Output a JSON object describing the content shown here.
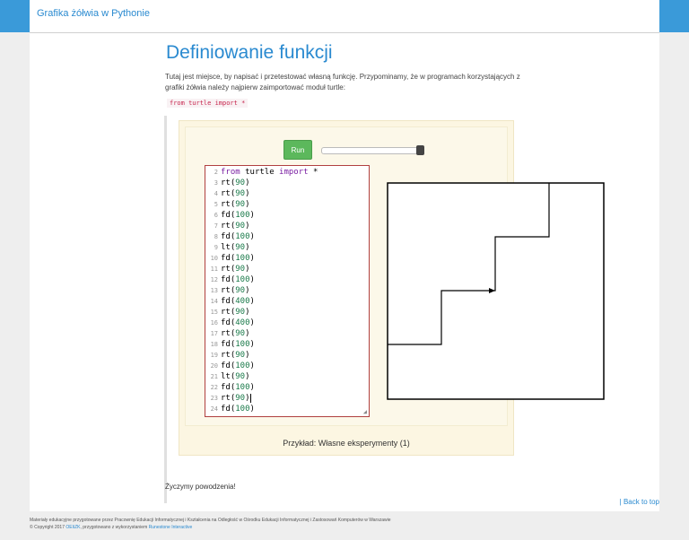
{
  "navbar": {
    "brand": "Grafika żółwia w Pythonie"
  },
  "page": {
    "title": "Definiowanie funkcji",
    "intro": "Tutaj jest miejsce, by napisać i przetestować własną funkcję. Przypominamy, że w programach korzystających z grafiki żółwia należy najpierw zaimportować moduł turtle:",
    "import_code": "from turtle import *",
    "closing": "Życzymy powodzenia!",
    "back_to_top": "| Back to top"
  },
  "activity": {
    "run_label": "Run",
    "speed_value": 1.0,
    "caption": "Przykład: Własne eksperymenty (1)",
    "code_lines": [
      {
        "n": "2",
        "text": "from turtle import *"
      },
      {
        "n": "3",
        "text": "rt(90)"
      },
      {
        "n": "4",
        "text": "rt(90)"
      },
      {
        "n": "5",
        "text": "rt(90)"
      },
      {
        "n": "6",
        "text": "fd(100)"
      },
      {
        "n": "7",
        "text": "rt(90)"
      },
      {
        "n": "8",
        "text": "fd(100)"
      },
      {
        "n": "9",
        "text": "lt(90)"
      },
      {
        "n": "10",
        "text": "fd(100)"
      },
      {
        "n": "11",
        "text": "rt(90)"
      },
      {
        "n": "12",
        "text": "fd(100)"
      },
      {
        "n": "13",
        "text": "rt(90)"
      },
      {
        "n": "14",
        "text": "fd(400)"
      },
      {
        "n": "15",
        "text": "rt(90)"
      },
      {
        "n": "16",
        "text": "fd(400)"
      },
      {
        "n": "17",
        "text": "rt(90)"
      },
      {
        "n": "18",
        "text": "fd(100)"
      },
      {
        "n": "19",
        "text": "rt(90)"
      },
      {
        "n": "20",
        "text": "fd(100)"
      },
      {
        "n": "21",
        "text": "lt(90)"
      },
      {
        "n": "22",
        "text": "fd(100)"
      },
      {
        "n": "23",
        "text": "rt(90)"
      },
      {
        "n": "24",
        "text": "fd(100)"
      }
    ]
  },
  "footer": {
    "line1": "Materiały edukacyjne przygotowane przez Pracownię Edukacji Informatycznej i Kształcenia na Odległość w Ośrodku Edukacji Informatycznej i Zastosowań Komputerów w Warszawie",
    "line2_prefix": "© Copyright 2017 ",
    "line2_link1": "OEIiZK",
    "line2_middle": ", przygotowano z wykorzystaniem ",
    "line2_link2": "Runestone Interactive"
  },
  "colors": {
    "accent": "#3a9ad9",
    "run_button": "#5cb85c",
    "activity_bg": "#fcf6e2"
  }
}
